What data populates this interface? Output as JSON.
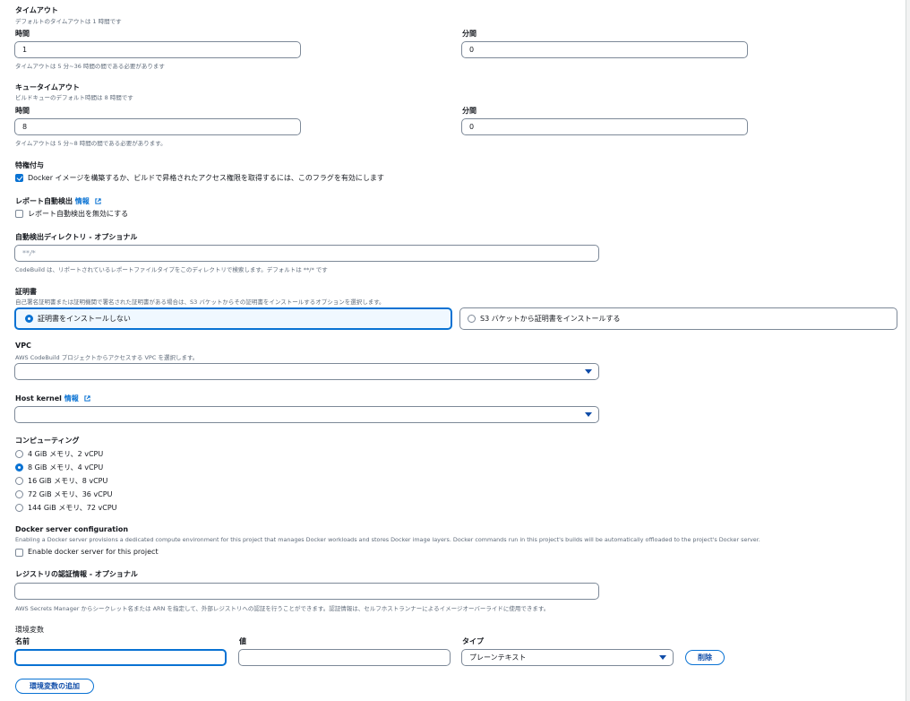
{
  "timeout": {
    "title": "タイムアウト",
    "desc": "デフォルトのタイムアウトは 1 時間です",
    "hours_label": "時間",
    "hours_value": "1",
    "minutes_label": "分間",
    "minutes_value": "0",
    "hint": "タイムアウトは 5 分~36 時間の間である必要があります"
  },
  "queue_timeout": {
    "title": "キュータイムアウト",
    "desc": "ビルドキューのデフォルト時間は 8 時間です",
    "hours_label": "時間",
    "hours_value": "8",
    "minutes_label": "分間",
    "minutes_value": "0",
    "hint": "タイムアウトは 5 分~8 時間の間である必要があります。"
  },
  "privileged": {
    "title": "特権付与",
    "checkbox_label": "Docker イメージを構築するか、ビルドで昇格されたアクセス権限を取得するには、このフラグを有効にします",
    "checked": true
  },
  "report_discovery": {
    "title": "レポート自動検出",
    "info_link": "情報",
    "checkbox_label": "レポート自動検出を無効にする",
    "checked": false
  },
  "discovery_dir": {
    "title": "自動検出ディレクトリ - オプショナル",
    "placeholder": "**/*",
    "hint": "CodeBuild は、リポートされているレポートファイルタイプをこのディレクトリで検索します。デフォルトは **/* です"
  },
  "certificate": {
    "title": "証明書",
    "desc": "自己署名証明書または証明機関で署名された証明書がある場合は、S3 バケットからその証明書をインストールするオプションを選択します。",
    "option_none": "証明書をインストールしない",
    "option_s3": "S3 バケットから証明書をインストールする",
    "selected": "none"
  },
  "vpc": {
    "title": "VPC",
    "desc": "AWS CodeBuild プロジェクトからアクセスする VPC を選択します。",
    "value": ""
  },
  "host_kernel": {
    "title": "Host kernel",
    "info_link": "情報",
    "value": ""
  },
  "compute": {
    "title": "コンピューティング",
    "options": [
      "4 GiB メモリ、2 vCPU",
      "8 GiB メモリ、4 vCPU",
      "16 GiB メモリ、8 vCPU",
      "72 GiB メモリ、36 vCPU",
      "144 GiB メモリ、72 vCPU"
    ],
    "selected_index": 1
  },
  "docker_server": {
    "title": "Docker server configuration",
    "desc": "Enabling a Docker server provisions a dedicated compute environment for this project that manages Docker workloads and stores Docker image layers. Docker commands run in this project's builds will be automatically offloaded to the project's Docker server.",
    "checkbox_label": "Enable docker server for this project",
    "checked": false
  },
  "registry_credential": {
    "title": "レジストリの認証情報 - オプショナル",
    "value": "",
    "hint": "AWS Secrets Manager からシークレット名または ARN を指定して、外部レジストリへの認証を行うことができます。認証情報は、セルフホストランナーによるイメージオーバーライドに使用できます。"
  },
  "env_vars": {
    "title": "環境変数",
    "name_label": "名前",
    "value_label": "値",
    "type_label": "タイプ",
    "name_value": "",
    "value_value": "",
    "type_value": "プレーンテキスト",
    "delete_button": "削除",
    "add_button": "環境変数の追加"
  },
  "colors": {
    "accent": "#0972d3",
    "text": "#16191f",
    "muted": "#5f6b7a",
    "border": "#7d8998"
  }
}
